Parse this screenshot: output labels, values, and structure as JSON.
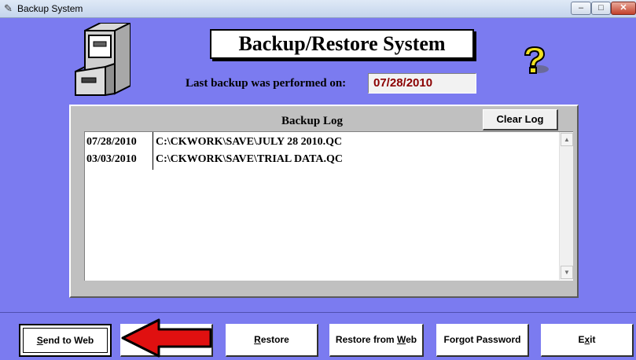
{
  "window": {
    "title": "Backup System",
    "controls": {
      "minimize": "–",
      "maximize": "□",
      "close": "✕"
    }
  },
  "header": {
    "heading": "Backup/Restore System",
    "last_backup_label": "Last backup was performed on:",
    "last_backup_value": "07/28/2010"
  },
  "log": {
    "title": "Backup Log",
    "clear_button": "Clear Log",
    "rows": [
      {
        "date": "07/28/2010",
        "path": "C:\\CKWORK\\SAVE\\JULY 28 2010.QC"
      },
      {
        "date": "03/03/2010",
        "path": "C:\\CKWORK\\SAVE\\TRIAL DATA.QC"
      }
    ]
  },
  "buttons": {
    "send_to_web": {
      "pre": "",
      "key": "S",
      "post": "end to Web"
    },
    "restore": {
      "pre": "",
      "key": "R",
      "post": "estore"
    },
    "restore_from_web": {
      "pre": "Restore from ",
      "key": "W",
      "post": "eb"
    },
    "forgot_password": {
      "pre": "Forgot Password",
      "key": "",
      "post": ""
    },
    "exit": {
      "pre": "E",
      "key": "x",
      "post": "it"
    }
  },
  "icons": {
    "window_icon": "pencil-icon",
    "cabinet": "file-cabinet-icon",
    "help": "question-mark-icon",
    "arrow": "red-arrow-icon"
  },
  "colors": {
    "background": "#7b7bf0",
    "date_value": "#8b0000",
    "arrow": "#e01010"
  }
}
